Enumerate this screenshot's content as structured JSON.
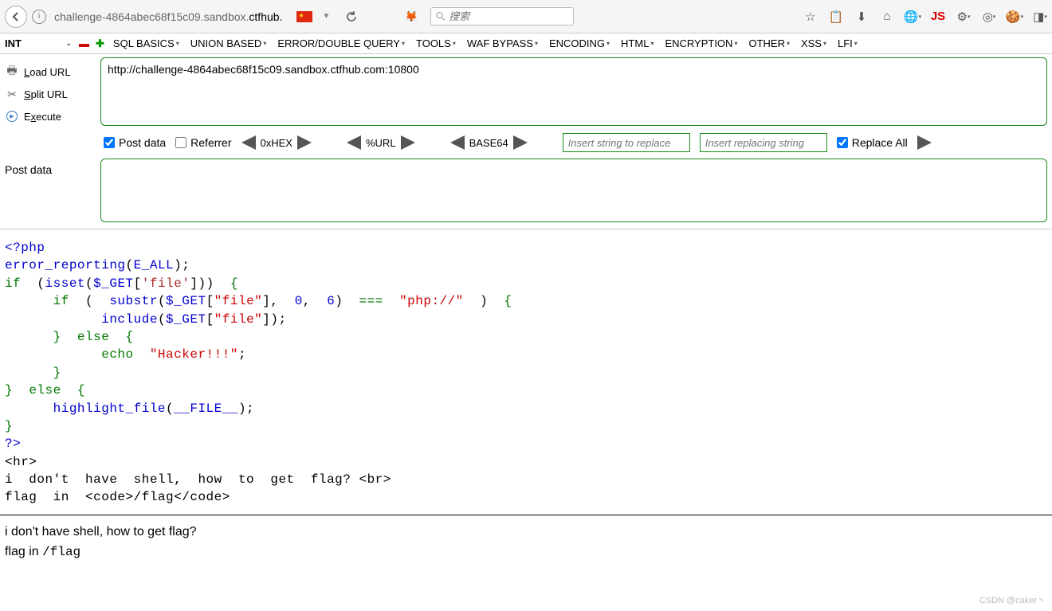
{
  "browser": {
    "url_pre": "challenge-4864abec68f15c09.sandbox.",
    "url_domain": "ctfhub.",
    "search_placeholder": "搜索"
  },
  "hackbar_menu": {
    "int": "INT",
    "items": [
      "SQL BASICS",
      "UNION BASED",
      "ERROR/DOUBLE QUERY",
      "TOOLS",
      "WAF BYPASS",
      "ENCODING",
      "HTML",
      "ENCRYPTION",
      "OTHER",
      "XSS",
      "LFI"
    ]
  },
  "hackbar_side": {
    "load": "Load URL",
    "split": "Split URL",
    "execute": "Execute"
  },
  "hackbar_url": "http://challenge-4864abec68f15c09.sandbox.ctfhub.com:10800",
  "hackbar_opts": {
    "postdata": "Post data",
    "referrer": "Referrer",
    "hex": "0xHEX",
    "url": "%URL",
    "base64": "BASE64",
    "replace_in": "Insert string to replace",
    "replace_with": "Insert replacing string",
    "replace_all": "Replace All"
  },
  "postdata_label": "Post data",
  "code": {
    "l1_open": "<?php",
    "l2_fn": "error_reporting",
    "l2_const": "E_ALL",
    "l3_if": "if",
    "l3_fn": "isset",
    "l3_var": "$_GET",
    "l3_key": "'file'",
    "l4_if": "if",
    "l4_fn": "substr",
    "l4_var": "$_GET",
    "l4_key": "\"file\"",
    "l4_n0": "0",
    "l4_n6": "6",
    "l4_op": "===",
    "l4_str": "\"php://\"",
    "l5_fn": "include",
    "l5_var": "$_GET",
    "l5_key": "\"file\"",
    "l6_else": "else",
    "l7_echo": "echo",
    "l7_str": "\"Hacker!!!\"",
    "l8_else": "else",
    "l9_fn": "highlight_file",
    "l9_const": "__FILE__",
    "l10_close": "?>",
    "hr": "<hr>",
    "txt1_a": "i  don't  have  shell,  how  to  get  flag? ",
    "txt1_br": "<br>",
    "txt2_a": "flag  in  ",
    "txt2_code1": "<code>",
    "txt2_path": "/flag",
    "txt2_code2": "</code>"
  },
  "rendered": {
    "line1": "i don't have shell, how to get flag?",
    "line2a": "flag in ",
    "line2b": "/flag"
  },
  "watermark": "CSDN @caker丶"
}
